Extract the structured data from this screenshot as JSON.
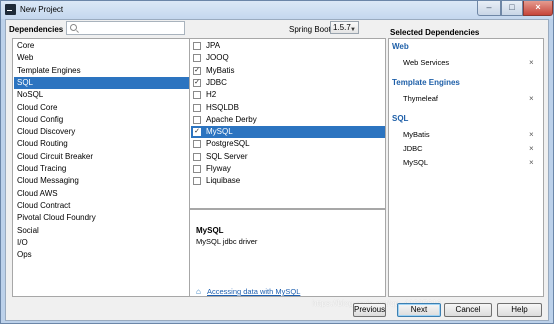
{
  "window": {
    "title": "New Project",
    "min": "–",
    "max": "□",
    "close": "×"
  },
  "top": {
    "dependencies_label": "Dependencies",
    "search_placeholder": "",
    "spring_boot_label": "Spring Boot",
    "spring_boot_version": "1.5.7"
  },
  "categories": [
    "Core",
    "Web",
    "Template Engines",
    "SQL",
    "NoSQL",
    "Cloud Core",
    "Cloud Config",
    "Cloud Discovery",
    "Cloud Routing",
    "Cloud Circuit Breaker",
    "Cloud Tracing",
    "Cloud Messaging",
    "Cloud AWS",
    "Cloud Contract",
    "Pivotal Cloud Foundry",
    "Social",
    "I/O",
    "Ops"
  ],
  "selected_category_index": 3,
  "dependencies": [
    {
      "label": "JPA",
      "checked": false
    },
    {
      "label": "JOOQ",
      "checked": false
    },
    {
      "label": "MyBatis",
      "checked": true
    },
    {
      "label": "JDBC",
      "checked": true
    },
    {
      "label": "H2",
      "checked": false
    },
    {
      "label": "HSQLDB",
      "checked": false
    },
    {
      "label": "Apache Derby",
      "checked": false
    },
    {
      "label": "MySQL",
      "checked": true,
      "selected": true
    },
    {
      "label": "PostgreSQL",
      "checked": false
    },
    {
      "label": "SQL Server",
      "checked": false
    },
    {
      "label": "Flyway",
      "checked": false
    },
    {
      "label": "Liquibase",
      "checked": false
    }
  ],
  "description": {
    "title": "MySQL",
    "text": "MySQL jdbc driver",
    "guide_link": "Accessing data with MySQL"
  },
  "selected_panel": {
    "title": "Selected Dependencies",
    "groups": [
      {
        "name": "Web",
        "items": [
          "Web Services"
        ]
      },
      {
        "name": "Template Engines",
        "items": [
          "Thymeleaf"
        ]
      },
      {
        "name": "SQL",
        "items": [
          "MyBatis",
          "JDBC",
          "MySQL"
        ]
      }
    ],
    "remove_glyph": "×"
  },
  "buttons": {
    "previous": "Previous",
    "next": "Next",
    "cancel": "Cancel",
    "help": "Help"
  },
  "watermark": "https://blog.csdn.net/qq_41007616",
  "colors": {
    "selection": "#2c74c0",
    "group_heading": "#1e5fa8"
  }
}
